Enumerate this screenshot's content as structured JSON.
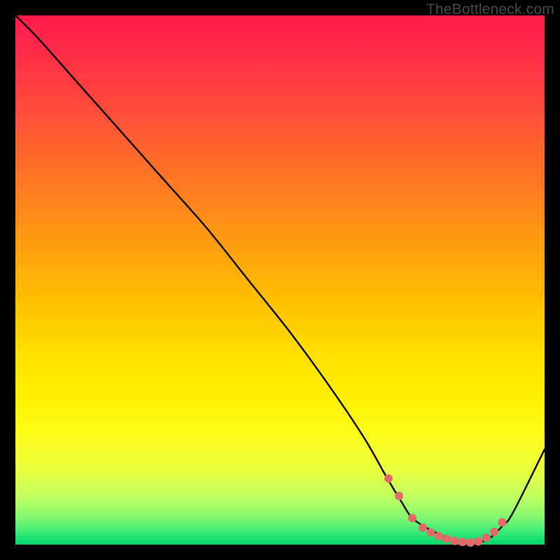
{
  "watermark": "TheBottleneck.com",
  "chart_data": {
    "type": "line",
    "title": "",
    "xlabel": "",
    "ylabel": "",
    "xlim": [
      0,
      100
    ],
    "ylim": [
      0,
      100
    ],
    "grid": false,
    "legend": false,
    "series": [
      {
        "name": "bottleneck-curve",
        "color": "#000000",
        "x": [
          0,
          4,
          12,
          20,
          28,
          36,
          44,
          52,
          60,
          66,
          70,
          73,
          75,
          78,
          80,
          82,
          84,
          86,
          88,
          90,
          92,
          94,
          100
        ],
        "y": [
          100,
          96,
          87,
          78,
          69,
          60,
          50,
          40,
          29,
          20,
          13,
          8,
          5,
          3,
          2,
          1,
          0.5,
          0.3,
          0.5,
          1.5,
          3.5,
          6,
          18
        ]
      }
    ],
    "markers": {
      "name": "highlight-dots",
      "color": "#e46a6a",
      "radius": 6,
      "x": [
        70.5,
        72.5,
        75,
        77,
        78.5,
        80,
        81.5,
        83,
        84.5,
        86,
        87.5,
        89,
        90.5,
        92
      ],
      "y": [
        12.5,
        9.2,
        5.0,
        3.2,
        2.3,
        1.6,
        1.1,
        0.7,
        0.5,
        0.4,
        0.6,
        1.3,
        2.4,
        4.2
      ]
    }
  }
}
